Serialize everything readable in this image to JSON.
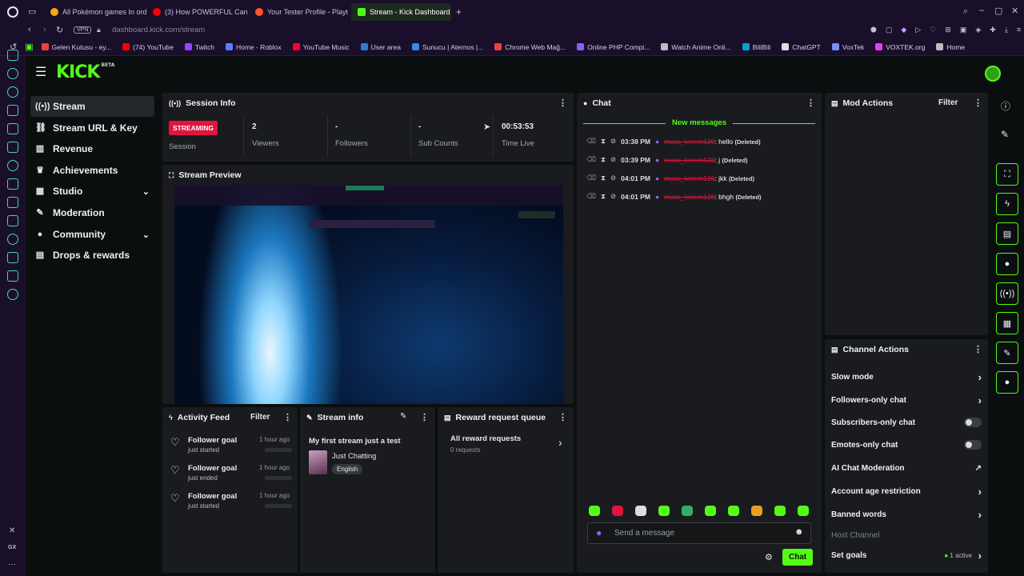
{
  "browser": {
    "tabs": [
      {
        "title": "All Pokémon games In orde",
        "color": "#f6a619"
      },
      {
        "title": "(3) How POWERFUL Can",
        "color": "#ff0000"
      },
      {
        "title": "Your Tester Profile - Playt",
        "color": "#ff5533"
      },
      {
        "title": "Stream - Kick Dashboard",
        "color": "#53fc18",
        "active": true
      }
    ],
    "new_tab": "+",
    "vpn_badge": "VPN",
    "url_host": "dashboard.kick.com",
    "url_path": "/stream",
    "bookmarks": [
      {
        "label": "Gelen Kutusu - ey...",
        "color": "#ea4335"
      },
      {
        "label": "(74) YouTube",
        "color": "#ff0000"
      },
      {
        "label": "Twitch",
        "color": "#9147ff"
      },
      {
        "label": "Home - Roblox",
        "color": "#5a7dff"
      },
      {
        "label": "YouTube Music",
        "color": "#ff0033"
      },
      {
        "label": "User area",
        "color": "#2b7bd8"
      },
      {
        "label": "Sunucu | Aternos |...",
        "color": "#2f8fe0"
      },
      {
        "label": "Chrome Web Mağ...",
        "color": "#e8453c"
      },
      {
        "label": "Online PHP Compi...",
        "color": "#8b5cf6"
      },
      {
        "label": "Watch Anime Onli...",
        "color": "#bbbbbb"
      },
      {
        "label": "BiliBili",
        "color": "#00a1d6"
      },
      {
        "label": "ChatGPT",
        "color": "#dddddd"
      },
      {
        "label": "VoxTek",
        "color": "#7b8cff"
      },
      {
        "label": "VOXTEK.org",
        "color": "#e83cf0"
      },
      {
        "label": "Home",
        "color": "#bbbbbb"
      }
    ]
  },
  "kick": {
    "logo": "KICK",
    "logo_badge": "BETA",
    "accent": "#53fc18",
    "nav": [
      {
        "label": "Stream",
        "icon": "stream-icon",
        "active": true
      },
      {
        "label": "Stream URL & Key",
        "icon": "link-icon"
      },
      {
        "label": "Revenue",
        "icon": "chart-icon"
      },
      {
        "label": "Achievements",
        "icon": "trophy-icon"
      },
      {
        "label": "Studio",
        "icon": "studio-icon",
        "expandable": true
      },
      {
        "label": "Moderation",
        "icon": "wrench-icon"
      },
      {
        "label": "Community",
        "icon": "people-icon",
        "expandable": true
      },
      {
        "label": "Drops & rewards",
        "icon": "gift-icon"
      }
    ]
  },
  "session": {
    "title": "Session Info",
    "status_badge": "STREAMING",
    "status_label": "Session",
    "viewers_value": "2",
    "viewers_label": "Viewers",
    "followers_value": "-",
    "followers_label": "Followers",
    "subs_value": "-",
    "subs_label": "Sub Counts",
    "time_value": "00:53:53",
    "time_label": "Time Live"
  },
  "preview": {
    "title": "Stream Preview"
  },
  "activity": {
    "title": "Activity Feed",
    "filter": "Filter",
    "items": [
      {
        "title": "Follower goal",
        "status": "just started",
        "time": "1 hour ago"
      },
      {
        "title": "Follower goal",
        "status": "just ended",
        "time": "1 hour ago"
      },
      {
        "title": "Follower goal",
        "status": "just started",
        "time": "1 hour ago"
      }
    ]
  },
  "stream_info": {
    "title": "Stream info",
    "stream_title": "My first stream just a test",
    "category": "Just Chatting",
    "language": "English"
  },
  "rewards": {
    "title": "Reward request queue",
    "all_label": "All reward requests",
    "count": "0 requests"
  },
  "chat": {
    "title": "Chat",
    "divider": "New messages",
    "messages": [
      {
        "time": "03:38 PM",
        "user": "musa_kerem126",
        "text": ": hello",
        "status": "(Deleted)"
      },
      {
        "time": "03:39 PM",
        "user": "musa_kerem126",
        "text": ": j",
        "status": "(Deleted)"
      },
      {
        "time": "04:01 PM",
        "user": "musa_kerem126",
        "text": ": jkk",
        "status": "(Deleted)"
      },
      {
        "time": "04:01 PM",
        "user": "musa_kerem126",
        "text": ": bhgh",
        "status": "(Deleted)"
      }
    ],
    "placeholder": "Send a message",
    "send_label": "Chat"
  },
  "mod_actions": {
    "title": "Mod Actions",
    "filter": "Filter"
  },
  "channel_actions": {
    "title": "Channel Actions",
    "items": [
      {
        "label": "Slow mode",
        "control": "arrow"
      },
      {
        "label": "Followers-only chat",
        "control": "arrow"
      },
      {
        "label": "Subscribers-only chat",
        "control": "toggle"
      },
      {
        "label": "Emotes-only chat",
        "control": "toggle"
      },
      {
        "label": "AI Chat Moderation",
        "control": "external"
      },
      {
        "label": "Account age restriction",
        "control": "arrow"
      },
      {
        "label": "Banned words",
        "control": "arrow"
      },
      {
        "label": "Host Channel",
        "control": "none"
      },
      {
        "label": "Set goals",
        "control": "arrow",
        "badge": "1 active"
      }
    ]
  }
}
